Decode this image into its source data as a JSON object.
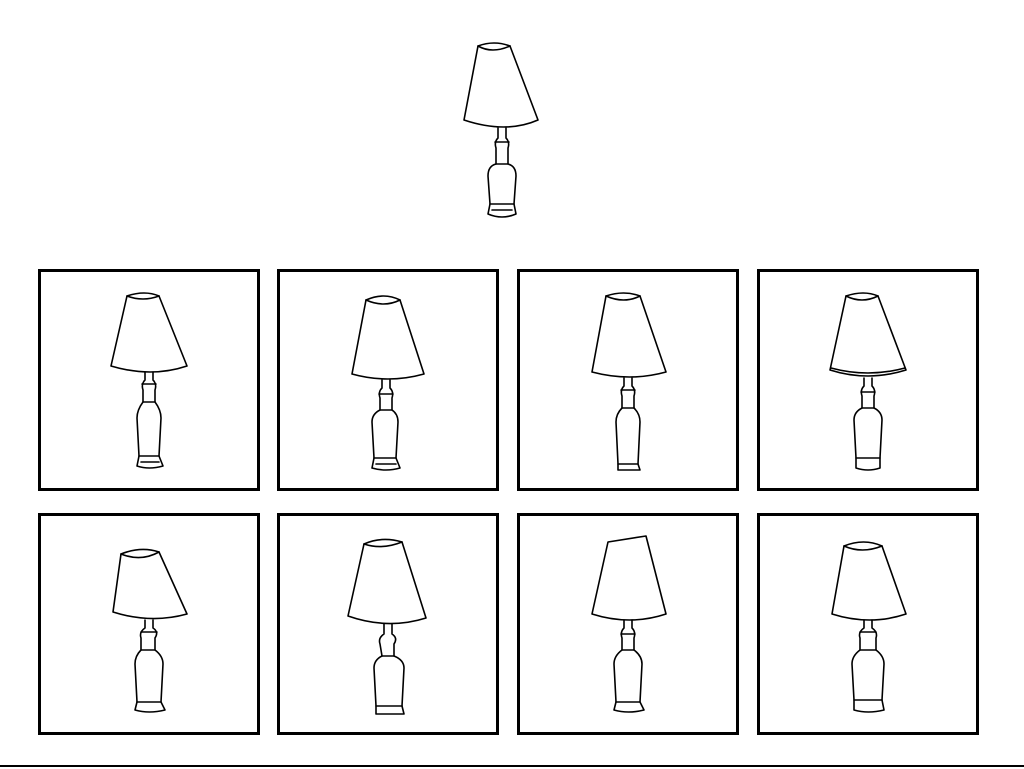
{
  "task": {
    "target_icon": "table-lamp-icon",
    "choices": [
      {
        "icon": "table-lamp-icon"
      },
      {
        "icon": "table-lamp-icon"
      },
      {
        "icon": "table-lamp-icon"
      },
      {
        "icon": "table-lamp-icon"
      },
      {
        "icon": "table-lamp-icon"
      },
      {
        "icon": "table-lamp-icon"
      },
      {
        "icon": "table-lamp-icon"
      },
      {
        "icon": "table-lamp-icon"
      }
    ]
  },
  "colors": {
    "line": "#000000",
    "background": "#ffffff"
  }
}
